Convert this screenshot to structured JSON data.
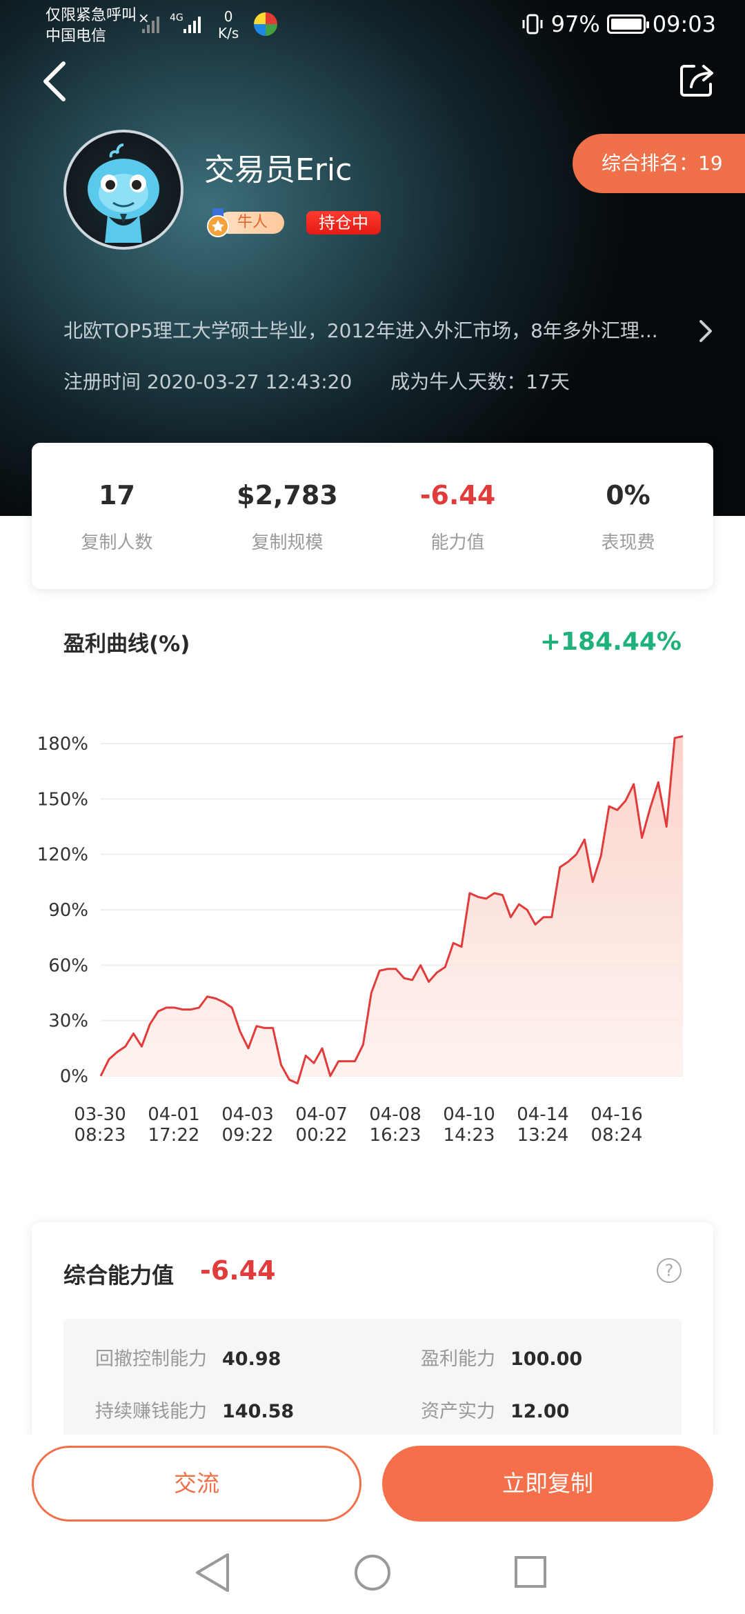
{
  "status_bar": {
    "carrier_line1": "仅限紧急呼叫",
    "carrier_line2": "中国电信",
    "network_type": "4G",
    "net_speed_value": "0",
    "net_speed_unit": "K/s",
    "battery": "97%",
    "time": "09:03"
  },
  "header": {
    "back_icon": "chevron-left-icon",
    "share_icon": "share-icon",
    "username": "交易员Eric",
    "badge_niu": "牛人",
    "badge_holding": "持仓中",
    "rank_label": "综合排名：19",
    "bio": "北欧TOP5理工大学硕士毕业，2012年进入外汇市场，8年多外汇理...",
    "register_time": "注册时间 2020-03-27 12:43:20",
    "niu_days": "成为牛人天数：17天"
  },
  "stats": [
    {
      "value": "17",
      "label": "复制人数"
    },
    {
      "value": "$2,783",
      "label": "复制规模"
    },
    {
      "value": "-6.44",
      "label": "能力值"
    },
    {
      "value": "0%",
      "label": "表现费"
    }
  ],
  "profit_curve": {
    "title": "盈利曲线(%)",
    "total_return": "+184.44%"
  },
  "chart_data": {
    "type": "area",
    "title": "",
    "xlabel": "",
    "ylabel": "",
    "ylim": [
      0,
      180
    ],
    "y_ticks": [
      "180%",
      "150%",
      "120%",
      "90%",
      "60%",
      "30%",
      "0%"
    ],
    "x_tick_labels": [
      [
        "03-30",
        "08:23"
      ],
      [
        "04-01",
        "17:22"
      ],
      [
        "04-03",
        "09:22"
      ],
      [
        "04-07",
        "00:22"
      ],
      [
        "04-08",
        "16:23"
      ],
      [
        "04-10",
        "14:23"
      ],
      [
        "04-14",
        "13:24"
      ],
      [
        "04-16",
        "08:24"
      ]
    ],
    "series": [
      {
        "values": [
          0,
          9,
          13,
          16,
          23,
          16,
          28,
          35,
          37,
          37,
          36,
          36,
          37,
          43,
          42,
          40,
          37,
          24,
          15,
          27,
          26,
          26,
          6,
          -2,
          -4,
          11,
          7,
          15,
          0,
          8,
          8,
          8,
          17,
          45,
          57,
          58,
          58,
          53,
          52,
          60,
          51,
          56,
          59,
          72,
          70,
          99,
          97,
          96,
          99,
          98,
          86,
          93,
          90,
          82,
          86,
          86,
          113,
          116,
          120,
          128,
          105,
          119,
          146,
          144,
          149,
          158,
          129,
          145,
          159,
          135,
          183,
          184
        ]
      }
    ],
    "line_color": "#e23b3b",
    "fill_color": "#fbd3cb",
    "grid": true
  },
  "ability": {
    "title": "综合能力值",
    "value": "-6.44",
    "help_icon": "question-circle-icon",
    "items": [
      {
        "label": "回撤控制能力",
        "value": "40.98"
      },
      {
        "label": "盈利能力",
        "value": "100.00"
      },
      {
        "label": "持续赚钱能力",
        "value": "140.58"
      },
      {
        "label": "资产实力",
        "value": "12.00"
      }
    ]
  },
  "bottom": {
    "chat_label": "交流",
    "copy_label": "立即复制"
  },
  "nav": {
    "back_icon": "triangle-back-icon",
    "home_icon": "circle-home-icon",
    "recents_icon": "square-recents-icon"
  },
  "colors": {
    "accent": "#f0704a",
    "negative": "#e23b3b",
    "positive": "#1eb27a"
  }
}
